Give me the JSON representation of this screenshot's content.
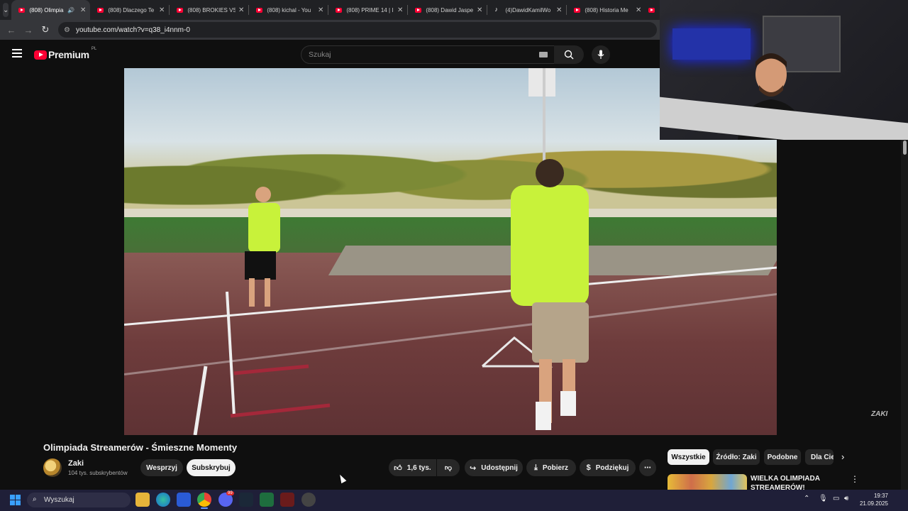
{
  "browser": {
    "tabs": [
      {
        "title": "(808) Olimpia",
        "icon": "youtube-icon",
        "active": true,
        "audio": true
      },
      {
        "title": "(808) Dlaczego Te",
        "icon": "youtube-icon"
      },
      {
        "title": "(808) BROKIES VS",
        "icon": "youtube-icon"
      },
      {
        "title": "(808) kichal - You",
        "icon": "youtube-icon"
      },
      {
        "title": "(808) PRIME 14 | I",
        "icon": "youtube-icon"
      },
      {
        "title": "(808) Dawid Jaspe",
        "icon": "youtube-icon"
      },
      {
        "title": "(4)DawidKamilWo",
        "icon": "tiktok-icon"
      },
      {
        "title": "(808) Historia Me",
        "icon": "youtube-icon"
      }
    ],
    "url": "youtube.com/watch?v=q38_i4nnm-0"
  },
  "youtube": {
    "logo_text": "Premium",
    "region": "PL",
    "search_placeholder": "Szukaj"
  },
  "video": {
    "title": "Olimpiada Streamerów - Śmieszne Momenty",
    "watermark": "ZAKI",
    "channel": {
      "name": "Zaki",
      "subscribers": "104 tys. subskrybentów"
    },
    "actions": {
      "support": "Wesprzyj",
      "subscribe": "Subskrybuj",
      "likes": "1,6 tys.",
      "share": "Udostępnij",
      "download": "Pobierz",
      "thanks": "Podziękuj"
    }
  },
  "sidebar": {
    "chips": [
      "Wszystkie",
      "Źródło: Zaki",
      "Podobne",
      "Dla Ciebie"
    ],
    "selected_chip": "Wszystkie",
    "first_recommendation_title": "WIELKA OLIMPIADA STREAMERÓW!"
  },
  "taskbar": {
    "search_placeholder": "Wyszukaj",
    "discord_badge": "99",
    "time": "19:37",
    "date": "21.09.2025"
  },
  "colors": {
    "youtube_red": "#ff0033",
    "background": "#0f0f0f",
    "taskbar": "#1f1f38"
  }
}
